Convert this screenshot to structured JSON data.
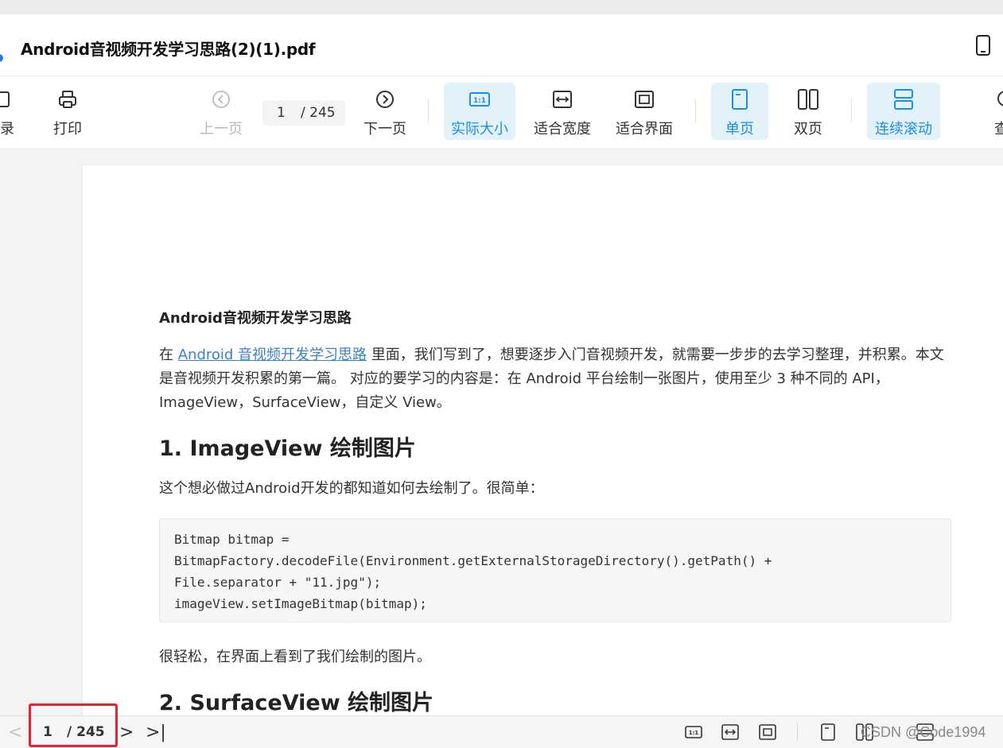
{
  "window": {
    "title": "Android音视频开发学习思路(2)(1).pdf",
    "icons": {
      "app": "app-dot-icon",
      "device": "phone-icon"
    }
  },
  "toolbar": {
    "toc_label": "录",
    "print_label": "打印",
    "prev_label": "上一页",
    "current_page": "1",
    "total_pages": "/ 245",
    "next_label": "下一页",
    "actual_size_label": "实际大小",
    "actual_size_glyph": "1:1",
    "fit_width_label": "适合宽度",
    "fit_page_label": "适合界面",
    "single_page_label": "单页",
    "double_page_label": "双页",
    "continuous_label": "连续滚动",
    "search_label": "查",
    "accent_color": "#1c8ee5"
  },
  "document": {
    "heading_small": "Android音视频开发学习思路",
    "para1_prefix": "在 ",
    "para1_link": "Android 音视频开发学习思路",
    "para1_rest": " 里面，我们写到了，想要逐步入门音视频开发，就需要一步步的去学习整理，并积累。本文是音视频开发积累的第一篇。 对应的要学习的内容是：在 Android 平台绘制一张图片，使用至少 3 种不同的 API，ImageView，SurfaceView，自定义 View。",
    "h1": "1. ImageView 绘制图片",
    "para2": "这个想必做过Android开发的都知道如何去绘制了。很简单：",
    "code_lines": [
      "Bitmap bitmap =",
      "BitmapFactory.decodeFile(Environment.getExternalStorageDirectory().getPath() +",
      "File.separator + \"11.jpg\");",
      "imageView.setImageBitmap(bitmap);"
    ],
    "para3": "很轻松，在界面上看到了我们绘制的图片。",
    "h2": "2. SurfaceView 绘制图片"
  },
  "statusbar": {
    "prev_glyph": "<",
    "current_page": "1",
    "total_pages": "/ 245",
    "next_glyph": ">",
    "last_glyph": ">|",
    "actual_size_glyph": "1:1",
    "watermark": "CSDN @Code1994",
    "highlight_color": "#e5242b"
  }
}
